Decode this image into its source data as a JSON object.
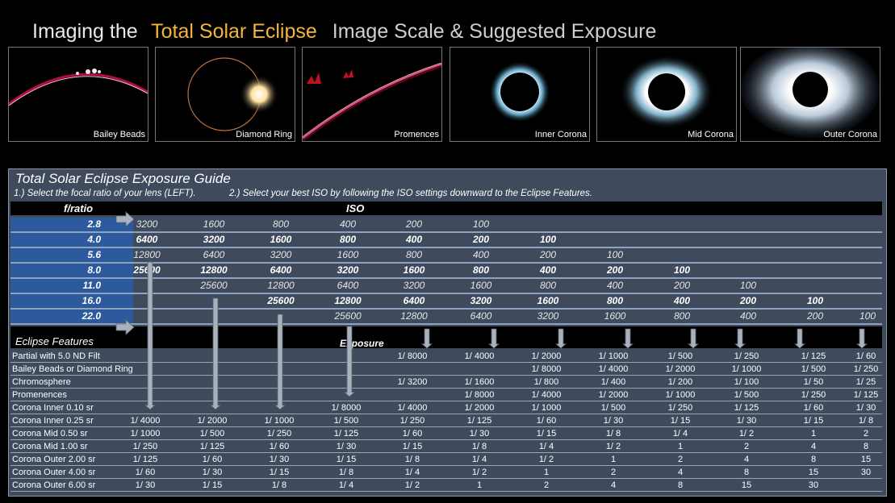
{
  "header": {
    "part1": "Imaging the",
    "part2": "Total Solar Eclipse",
    "part3": "Image Scale & Suggested Exposure"
  },
  "photos": [
    {
      "caption": "Bailey Beads"
    },
    {
      "caption": "Diamond Ring"
    },
    {
      "caption": "Promences"
    },
    {
      "caption": "Inner Corona"
    },
    {
      "caption": "Mid Corona"
    },
    {
      "caption": "Outer Corona"
    }
  ],
  "guide": {
    "title": "Total Solar Eclipse Exposure Guide",
    "step1": "1.) Select the focal ratio of your lens (LEFT).",
    "step2": "2.) Select your best ISO by following the ISO settings downward to the Eclipse Features.",
    "fratio_label": "f/ratio",
    "iso_label": "ISO",
    "features_label": "Eclipse Features",
    "exposure_label": "Exposure"
  },
  "fratio_rows": [
    {
      "f": "2.8",
      "iso": [
        "3200",
        "1600",
        "800",
        "400",
        "200",
        "100",
        "",
        "",
        "",
        "",
        "",
        ""
      ]
    },
    {
      "f": "4.0",
      "iso": [
        "6400",
        "3200",
        "1600",
        "800",
        "400",
        "200",
        "100",
        "",
        "",
        "",
        "",
        ""
      ]
    },
    {
      "f": "5.6",
      "iso": [
        "12800",
        "6400",
        "3200",
        "1600",
        "800",
        "400",
        "200",
        "100",
        "",
        "",
        "",
        ""
      ]
    },
    {
      "f": "8.0",
      "iso": [
        "25600",
        "12800",
        "6400",
        "3200",
        "1600",
        "800",
        "400",
        "200",
        "100",
        "",
        "",
        ""
      ]
    },
    {
      "f": "11.0",
      "iso": [
        "",
        "25600",
        "12800",
        "6400",
        "3200",
        "1600",
        "800",
        "400",
        "200",
        "100",
        "",
        ""
      ]
    },
    {
      "f": "16.0",
      "iso": [
        "",
        "",
        "25600",
        "12800",
        "6400",
        "3200",
        "1600",
        "800",
        "400",
        "200",
        "100",
        ""
      ]
    },
    {
      "f": "22.0",
      "iso": [
        "",
        "",
        "",
        "25600",
        "12800",
        "6400",
        "3200",
        "1600",
        "800",
        "400",
        "200",
        "100"
      ]
    }
  ],
  "features": [
    {
      "name": "Partial with 5.0 ND Filt",
      "exp": [
        "",
        "",
        "",
        "",
        "1/ 8000",
        "1/ 4000",
        "1/ 2000",
        "1/ 1000",
        "1/ 500",
        "1/ 250",
        "1/ 125",
        "1/ 60"
      ]
    },
    {
      "name": "Bailey Beads or Diamond Ring",
      "exp": [
        "",
        "",
        "",
        "",
        "",
        "",
        "1/ 8000",
        "1/ 4000",
        "1/ 2000",
        "1/ 1000",
        "1/ 500",
        "1/ 250"
      ]
    },
    {
      "name": "Chromosphere",
      "exp": [
        "",
        "",
        "",
        "",
        "1/ 3200",
        "1/ 1600",
        "1/ 800",
        "1/ 400",
        "1/ 200",
        "1/ 100",
        "1/ 50",
        "1/ 25"
      ]
    },
    {
      "name": "Promenences",
      "exp": [
        "",
        "",
        "",
        "",
        "",
        "1/ 8000",
        "1/ 4000",
        "1/ 2000",
        "1/ 1000",
        "1/ 500",
        "1/ 250",
        "1/ 125"
      ]
    },
    {
      "name": "Corona Inner 0.10 sr",
      "exp": [
        "",
        "",
        "",
        "1/ 8000",
        "1/ 4000",
        "1/ 2000",
        "1/ 1000",
        "1/ 500",
        "1/ 250",
        "1/ 125",
        "1/ 60",
        "1/ 30"
      ]
    },
    {
      "name": "Corona Inner 0.25 sr",
      "exp": [
        "1/ 4000",
        "1/ 2000",
        "1/ 1000",
        "1/ 500",
        "1/ 250",
        "1/ 125",
        "1/ 60",
        "1/ 30",
        "1/ 15",
        "1/ 30",
        "1/ 15",
        "1/ 8"
      ]
    },
    {
      "name": "Corona Mid 0.50 sr",
      "exp": [
        "1/ 1000",
        "1/ 500",
        "1/ 250",
        "1/ 125",
        "1/ 60",
        "1/ 30",
        "1/ 15",
        "1/ 8",
        "1/ 4",
        "1/ 2",
        "1",
        "2"
      ]
    },
    {
      "name": "Corona Mid 1.00 sr",
      "exp": [
        "1/ 250",
        "1/ 125",
        "1/ 60",
        "1/ 30",
        "1/ 15",
        "1/ 8",
        "1/ 4",
        "1/ 2",
        "1",
        "2",
        "4",
        "8"
      ]
    },
    {
      "name": "Corona Outer 2.00 sr",
      "exp": [
        "1/ 125",
        "1/ 60",
        "1/ 30",
        "1/ 15",
        "1/ 8",
        "1/ 4",
        "1/ 2",
        "1",
        "2",
        "4",
        "8",
        "15"
      ]
    },
    {
      "name": "Corona Outer 4.00 sr",
      "exp": [
        "1/ 60",
        "1/ 30",
        "1/ 15",
        "1/ 8",
        "1/ 4",
        "1/ 2",
        "1",
        "2",
        "4",
        "8",
        "15",
        "30"
      ]
    },
    {
      "name": "Corona Outer 6.00 sr",
      "exp": [
        "1/ 30",
        "1/ 15",
        "1/ 8",
        "1/ 4",
        "1/ 2",
        "1",
        "2",
        "4",
        "8",
        "15",
        "30",
        ""
      ]
    }
  ],
  "colors": {
    "accent": "#f4b63a",
    "panel": "#3f4a5c",
    "fratio_cell": "#2c5a9c",
    "arrow": "#a9b1bd"
  }
}
